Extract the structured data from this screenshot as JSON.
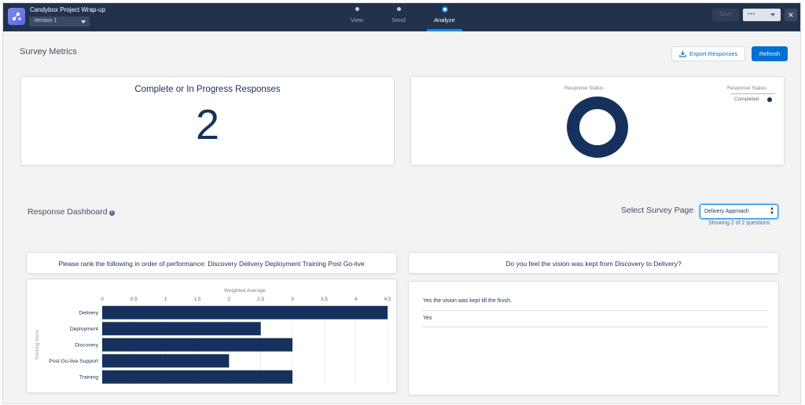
{
  "header": {
    "app_title": "Candybox Project Wrap-up",
    "version": "Version 1",
    "steps": [
      {
        "label": "View"
      },
      {
        "label": "Send"
      },
      {
        "label": "Analyze"
      }
    ],
    "active_step": "Analyze",
    "save_label": "Save",
    "more_label": "•••",
    "close_label": "×",
    "accent_color": "#1589ee",
    "bar_color": "#22324c"
  },
  "toolbar": {
    "page_title": "Survey Metrics",
    "export_label": "Export Responses",
    "refresh_label": "Refresh"
  },
  "metric": {
    "label": "Complete or In Progress Responses",
    "value": "2"
  },
  "status_chart": {
    "title": "Response Status",
    "legend_title": "Response Status",
    "legend_items": [
      {
        "label": "Completed",
        "color": "#16325c"
      }
    ]
  },
  "dashboard": {
    "title": "Response Dashboard",
    "info_icon": "i",
    "select_label": "Select Survey Page",
    "select_value": "Delivery Approach",
    "showing_text": "Showing 2 of 2 questions"
  },
  "question1": {
    "title": "Please rank the following in order of performance: Discovery Delivery Deployment Training Post Go-live"
  },
  "question2": {
    "title": "Do you feel the vision was kept from Discovery to Delivery?",
    "answers": [
      "Yes the vision was kept till the finish.",
      "Yes"
    ]
  },
  "chart_data": [
    {
      "type": "pie",
      "title": "Response Status",
      "labels": [
        "Completed"
      ],
      "values": [
        2
      ],
      "colors": [
        "#16325c"
      ],
      "legend": "top-right"
    },
    {
      "type": "bar",
      "orientation": "horizontal",
      "title": "Weighted Average",
      "ylabel": "Ranking Items",
      "categories": [
        "Delivery",
        "Deployment",
        "Discovery",
        "Post Go-live Support",
        "Training"
      ],
      "values": [
        4.5,
        2.5,
        3,
        2,
        3
      ],
      "ticks": [
        "0",
        "0.5",
        "1",
        "1.5",
        "2",
        "2.5",
        "3",
        "3.5",
        "4",
        "4.5"
      ],
      "xlim": [
        0,
        4.5
      ],
      "color": "#16325c",
      "grid": true
    }
  ]
}
